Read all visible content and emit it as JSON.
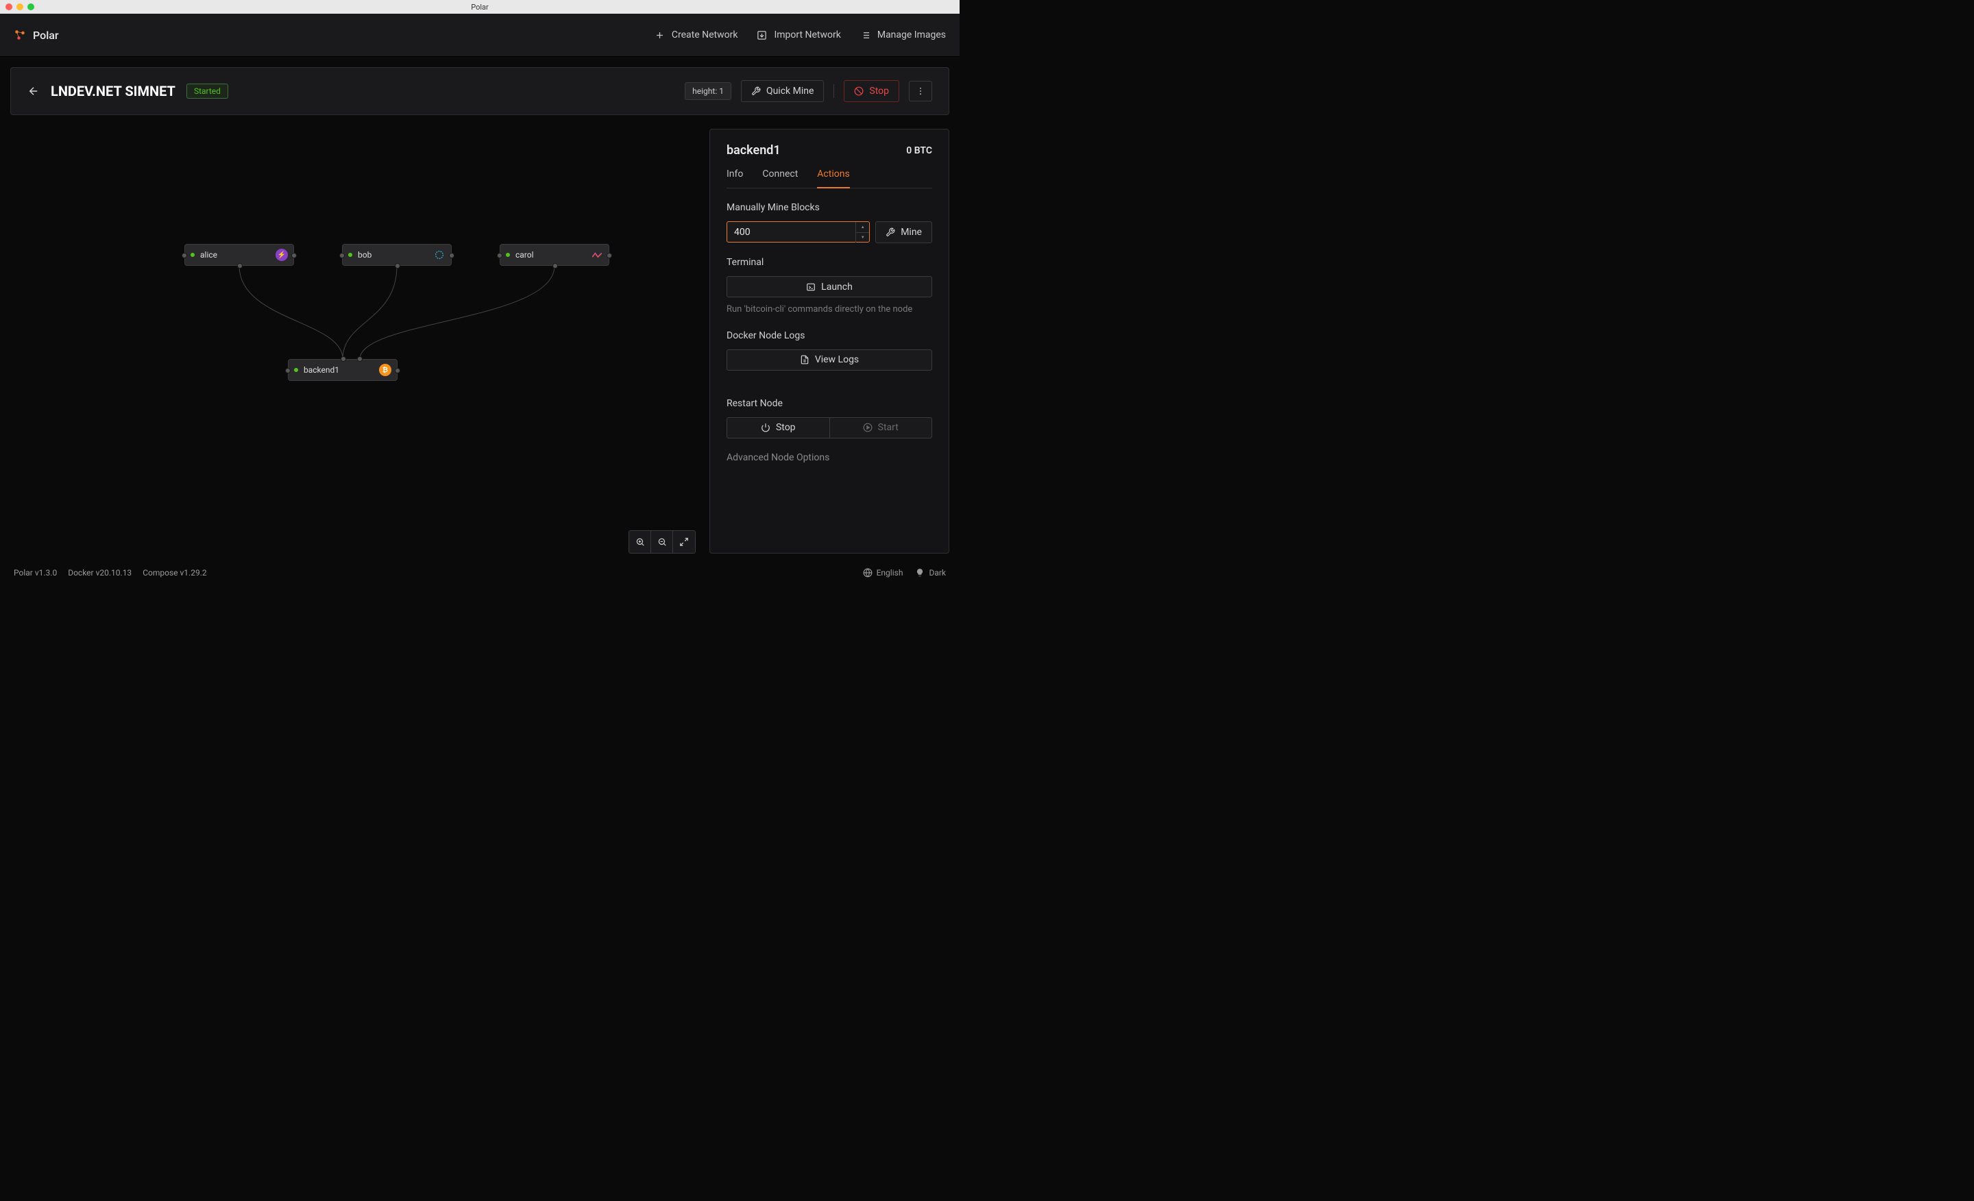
{
  "window": {
    "title": "Polar"
  },
  "brand": "Polar",
  "topbar": {
    "create": "Create Network",
    "import": "Import Network",
    "manage": "Manage Images"
  },
  "header": {
    "title": "LNDEV.NET SIMNET",
    "status": "Started",
    "height": "height: 1",
    "quick_mine": "Quick Mine",
    "stop": "Stop"
  },
  "nodes": {
    "alice": "alice",
    "bob": "bob",
    "carol": "carol",
    "backend1": "backend1"
  },
  "sidebar": {
    "title": "backend1",
    "balance": "0 BTC",
    "tabs": {
      "info": "Info",
      "connect": "Connect",
      "actions": "Actions"
    },
    "mine_label": "Manually Mine Blocks",
    "mine_value": "400",
    "mine_btn": "Mine",
    "terminal_label": "Terminal",
    "launch": "Launch",
    "terminal_help": "Run 'bitcoin-cli' commands directly on the node",
    "logs_label": "Docker Node Logs",
    "view_logs": "View Logs",
    "restart_label": "Restart Node",
    "stop_btn": "Stop",
    "start_btn": "Start",
    "advanced": "Advanced Node Options"
  },
  "footer": {
    "polar": "Polar v1.3.0",
    "docker": "Docker v20.10.13",
    "compose": "Compose v1.29.2",
    "lang": "English",
    "theme": "Dark"
  }
}
